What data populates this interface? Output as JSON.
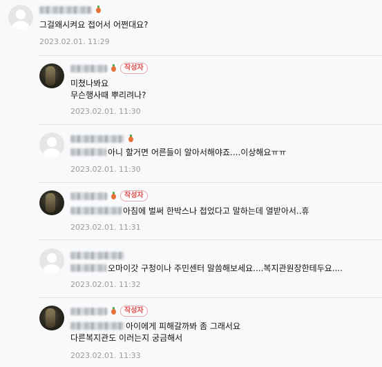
{
  "badge_label": "작성자",
  "comments": [
    {
      "lines": [
        "그걸왜시켜요 접어서 어쩐대요?"
      ],
      "time": "2023.02.01. 11:29"
    },
    {
      "lines": [
        "미쳤나봐요",
        "무슨행사때 뿌리려나?"
      ],
      "time": "2023.02.01. 11:30"
    },
    {
      "lines": [
        "아니 할거면 어른들이 알아서해야죠....이상해요ㅠㅠ"
      ],
      "time": "2023.02.01. 11:30"
    },
    {
      "lines": [
        "아침에 벌써 한박스나 접었다고 말하는데 열받아서..휴"
      ],
      "time": "2023.02.01. 11:31"
    },
    {
      "lines": [
        "오마이갓 구청이나 주민센터 말씀해보세요....복지관원장한테두요...."
      ],
      "time": "2023.02.01. 11:32"
    },
    {
      "lines": [
        "아이에게 피해갈까봐 좀 그래서요",
        "다른복지관도 이러는지 궁금해서"
      ],
      "time": "2023.02.01. 11:33"
    }
  ],
  "colors": {
    "badge": "#e34a4a",
    "carrot": "#e8703a",
    "timestamp": "#9a9a9a",
    "background": "#f8f9fa"
  }
}
